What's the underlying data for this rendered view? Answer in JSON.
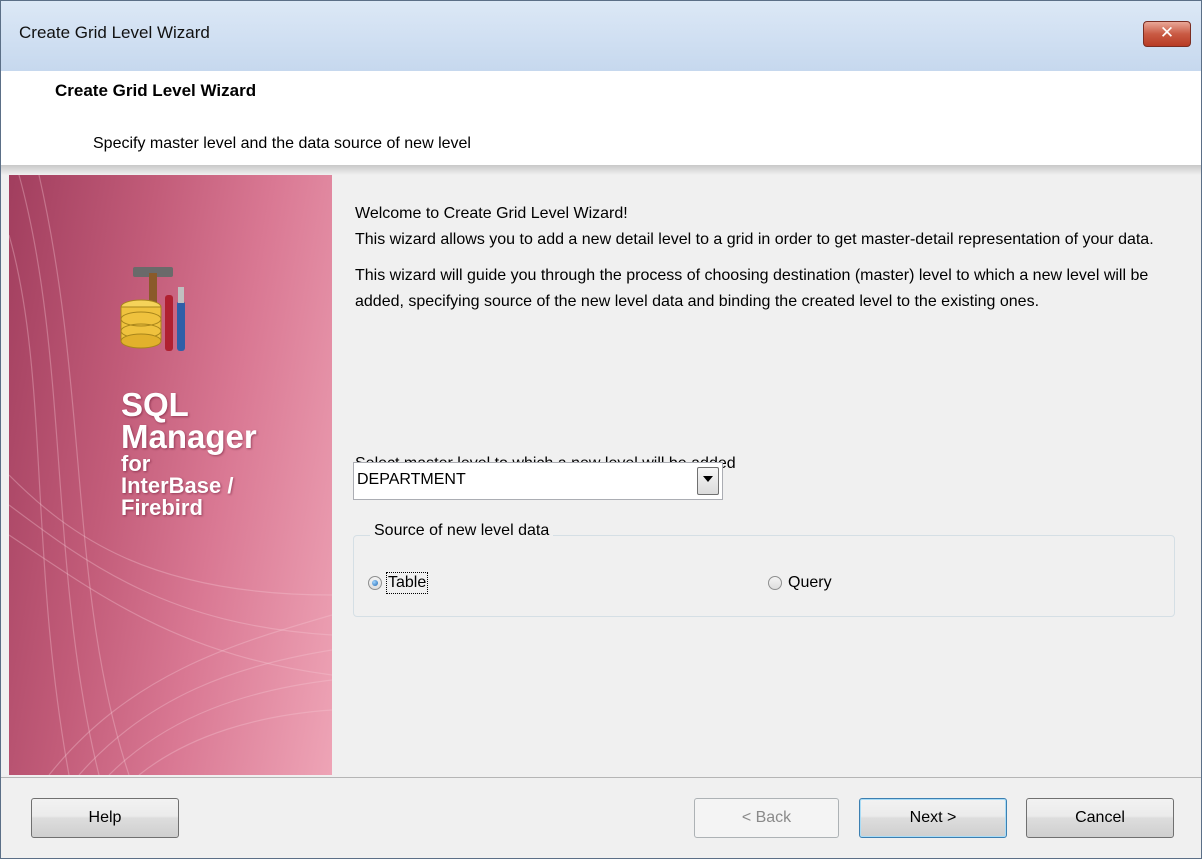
{
  "window": {
    "title": "Create Grid Level Wizard",
    "close_glyph": "✕"
  },
  "header": {
    "title": "Create Grid Level Wizard",
    "subtitle": "Specify master level and the data source of new level"
  },
  "banner": {
    "brand_line1": "SQL",
    "brand_line2": "Manager",
    "brand_line3": "for",
    "brand_line4": "InterBase /",
    "brand_line5": "Firebird",
    "icon": "database-tools-icon"
  },
  "content": {
    "welcome": "Welcome to Create Grid Level Wizard!",
    "intro": "This wizard allows you to add a new detail level to a grid in order to get master-detail representation of your data.",
    "guide": "This wizard will guide you through the process of choosing destination (master) level to which a new level will be added, specifying source of the new level data and binding the created level to the existing ones.",
    "select_label": "Select master level to which a new level will be added",
    "master_level_value": "DEPARTMENT"
  },
  "source_group": {
    "legend": "Source of new level data",
    "options": [
      {
        "label": "Table",
        "selected": true
      },
      {
        "label": "Query",
        "selected": false
      }
    ]
  },
  "buttons": {
    "help": "Help",
    "back": "< Back",
    "next": "Next >",
    "cancel": "Cancel"
  },
  "colors": {
    "banner_dark": "#a13e5e",
    "banner_light": "#eea4b6",
    "titlebar": "#c6d8ee",
    "close": "#c95a43"
  }
}
